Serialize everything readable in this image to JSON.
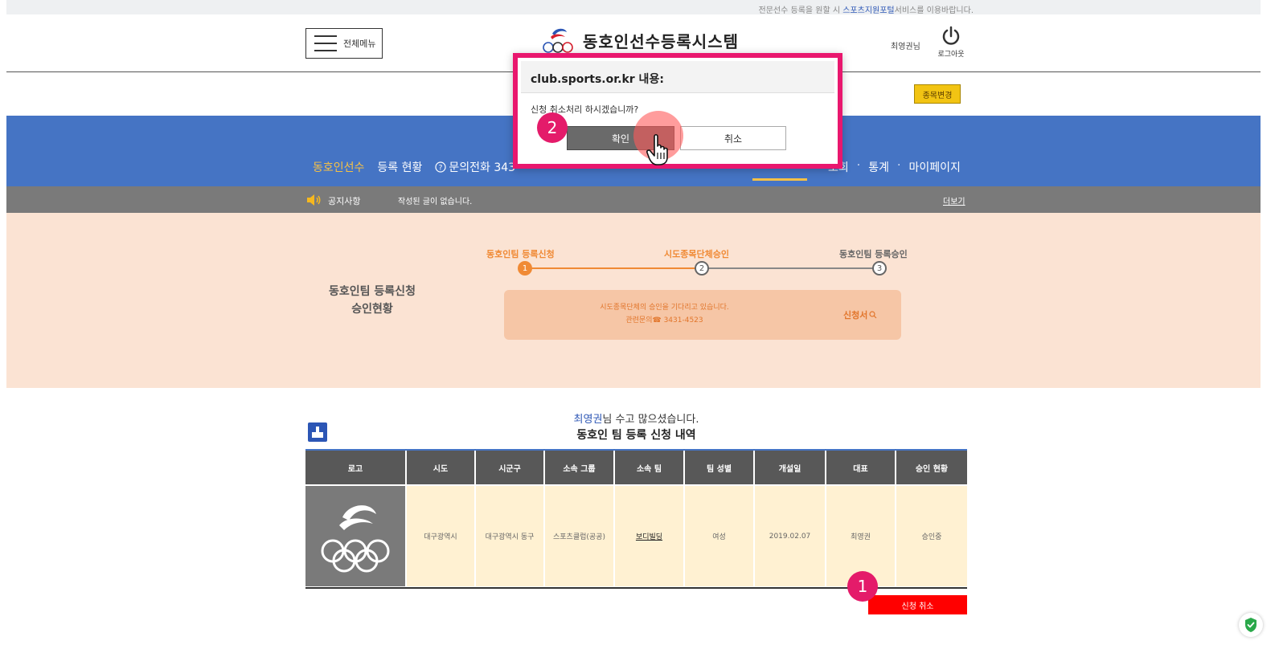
{
  "topbar": {
    "notice_prefix": "전문선수 등록을 원할 시 ",
    "notice_link": "스포츠지원포털",
    "notice_suffix": "서비스를 이용바랍니다."
  },
  "header": {
    "menu_label": "전체메뉴",
    "site_title": "동호인선수등록시스템",
    "user_name": "최영권님",
    "logout_label": "로그아웃"
  },
  "subbar": {
    "change_label": "종목변경"
  },
  "nav": {
    "left_items": [
      "동호인선수",
      "등록 현황",
      "문의전화 343"
    ],
    "right_items": [
      "조회",
      "통계",
      "마이페이지"
    ],
    "dot": "·"
  },
  "notice": {
    "label": "공지사항",
    "message": "작성된 글이 없습니다.",
    "more": "더보기"
  },
  "status": {
    "title_line1": "동호인팀 등록신청",
    "title_line2": "승인현황",
    "steps": [
      {
        "label": "동호인팀 등록신청",
        "num": "1",
        "state": "done"
      },
      {
        "label": "시도종목단체승인",
        "num": "2",
        "state": "current"
      },
      {
        "label": "동호인팀 등록승인",
        "num": "3",
        "state": "pending"
      }
    ],
    "box_line1": "시도종목단체의 승인을 기다리고 있습니다.",
    "box_line2": "관련문의☎  3431-4523",
    "doc_link": "신청서"
  },
  "greeting": {
    "name": "최영권",
    "suffix": "님 수고 많으셨습니다.",
    "list_title": "동호인 팀 등록 신청 내역"
  },
  "table": {
    "headers": [
      "로고",
      "시도",
      "시군구",
      "소속 그룹",
      "소속 팀",
      "팀 성별",
      "개설일",
      "대표",
      "승인 현황"
    ],
    "row": {
      "sido": "대구광역시",
      "sigungu": "대구광역시 동구",
      "group": "스포츠클럽(공공)",
      "team": "보디빌딩",
      "gender": "여성",
      "opened": "2019.02.07",
      "rep": "최영권",
      "status": "승인중"
    }
  },
  "cancel_button": "신청 취소",
  "badges": {
    "first": "1",
    "second": "2"
  },
  "dialog": {
    "origin": "club.sports.or.kr 내용:",
    "message": "신청 취소처리 하시겠습니까?",
    "ok": "확인",
    "cancel": "취소"
  },
  "colors": {
    "brand_blue": "#4574c4",
    "accent_orange": "#e2762c",
    "highlight_pink": "#e9176e",
    "cancel_red": "#ff0000"
  }
}
